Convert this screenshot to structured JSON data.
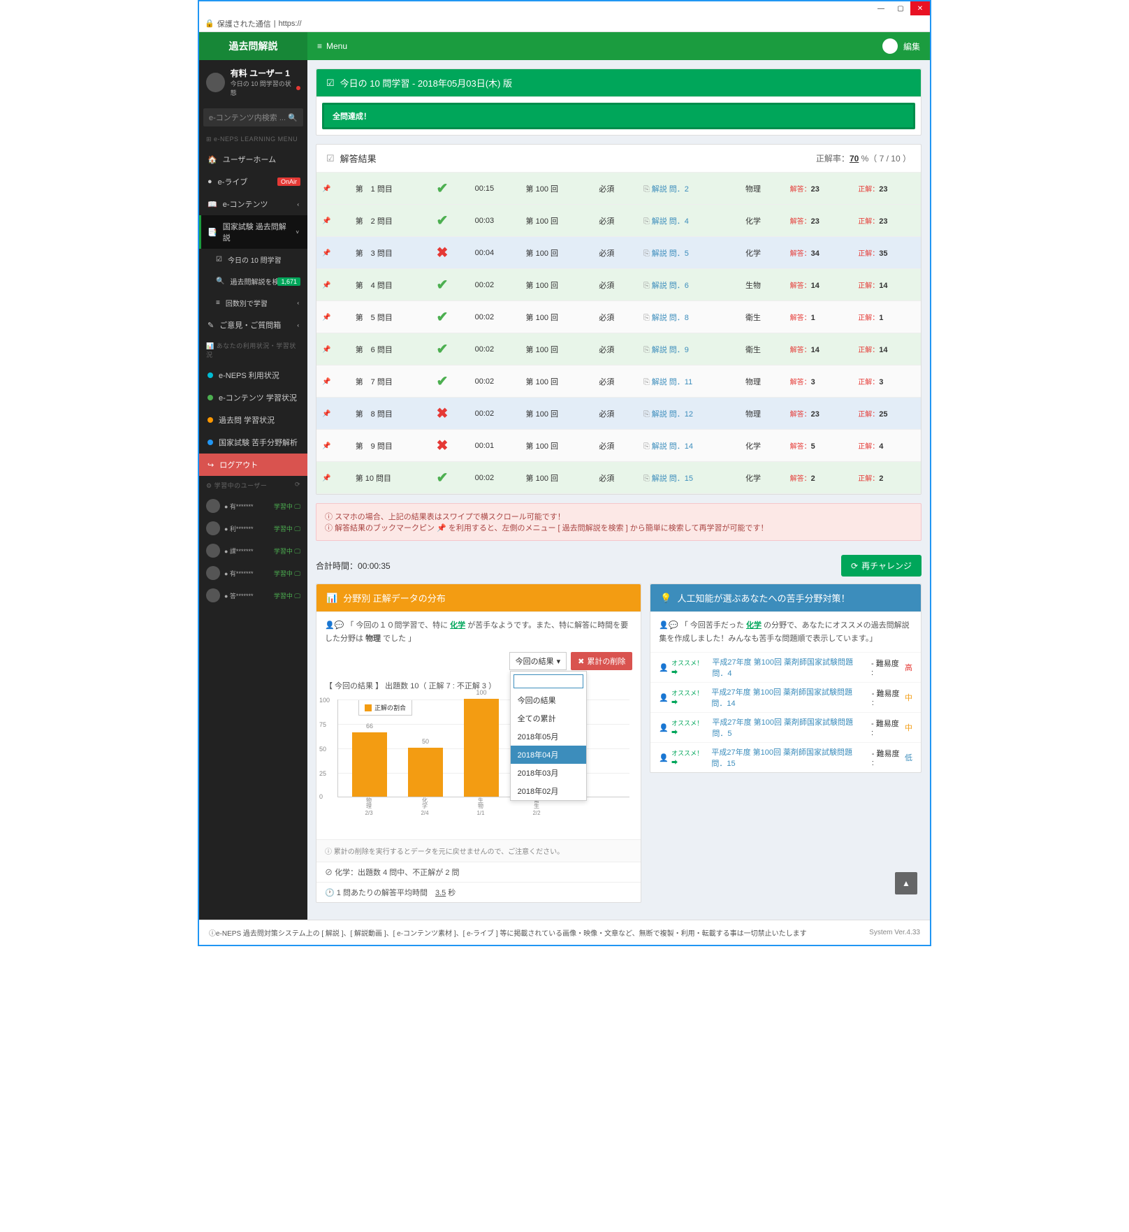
{
  "titlebar": {
    "min": "—",
    "max": "▢",
    "close": "✕"
  },
  "urlbar": {
    "secure": "保護された通信",
    "url": "https://"
  },
  "topbar": {
    "brand": "過去問解説",
    "menu": "Menu",
    "edit": "編集"
  },
  "user": {
    "name": "有料 ユーザー 1",
    "sub": "今日の 10 問学習の状態"
  },
  "search_placeholder": "e-コンテンツ内検索 ...",
  "side_header": "e-NEPS LEARNING MENU",
  "sidebar": [
    {
      "icon": "🏠",
      "label": "ユーザーホーム"
    },
    {
      "icon": "●",
      "label": "e-ライブ",
      "badge": "OnAir",
      "badge_cls": "onair"
    },
    {
      "icon": "📖",
      "label": "e-コンテンツ",
      "chev": "‹"
    },
    {
      "icon": "📑",
      "label": "国家試験 過去問解説",
      "chev": "˅",
      "active": true
    },
    {
      "icon": "☑",
      "label": "今日の 10 問学習",
      "sub": true
    },
    {
      "icon": "🔍",
      "label": "過去問解説を検索",
      "sub": true,
      "badge": "1,671"
    },
    {
      "icon": "≡",
      "label": "回数別で学習",
      "sub": true,
      "chev": "‹"
    },
    {
      "icon": "✎",
      "label": "ご意見・ご質問箱",
      "chev": "‹"
    }
  ],
  "side_header2": "あなたの利用状況・学習状況",
  "sidebar2": [
    {
      "dot": "dot-cyan",
      "label": "e-NEPS 利用状況"
    },
    {
      "dot": "dot-green",
      "label": "e-コンテンツ 学習状況"
    },
    {
      "dot": "dot-orange",
      "label": "過去問 学習状況"
    },
    {
      "dot": "dot-blue",
      "label": "国家試験 苦手分野解析"
    }
  ],
  "logout": "ログアウト",
  "side_header3": "学習中のユーザー",
  "online": [
    {
      "name": "有*******",
      "stat": "学習中"
    },
    {
      "name": "利*******",
      "stat": "学習中"
    },
    {
      "name": "課*******",
      "stat": "学習中"
    },
    {
      "name": "有*******",
      "stat": "学習中"
    },
    {
      "name": "答*******",
      "stat": "学習中"
    }
  ],
  "today_panel": {
    "title": "今日の 10 問学習 - 2018年05月03日(木) 版",
    "alert": "全問達成！"
  },
  "results_panel": {
    "title": "解答結果",
    "score_label": "正解率：",
    "score_pct": "70",
    "score_frac": " %（ 7 / 10 ）"
  },
  "rows": [
    {
      "n": "第　1 問目",
      "ok": true,
      "time": "00:15",
      "round": "第 100 回",
      "req": "必須",
      "link": "解説 問．2",
      "subj": "物理",
      "ans": "23",
      "cor": "23",
      "cls": "correct"
    },
    {
      "n": "第　2 問目",
      "ok": true,
      "time": "00:03",
      "round": "第 100 回",
      "req": "必須",
      "link": "解説 問．4",
      "subj": "化学",
      "ans": "23",
      "cor": "23",
      "cls": "correct"
    },
    {
      "n": "第　3 問目",
      "ok": false,
      "time": "00:04",
      "round": "第 100 回",
      "req": "必須",
      "link": "解説 問．5",
      "subj": "化学",
      "ans": "34",
      "cor": "35",
      "cls": "wrong"
    },
    {
      "n": "第　4 問目",
      "ok": true,
      "time": "00:02",
      "round": "第 100 回",
      "req": "必須",
      "link": "解説 問．6",
      "subj": "生物",
      "ans": "14",
      "cor": "14",
      "cls": "correct"
    },
    {
      "n": "第　5 問目",
      "ok": true,
      "time": "00:02",
      "round": "第 100 回",
      "req": "必須",
      "link": "解説 問．8",
      "subj": "衛生",
      "ans": "1",
      "cor": "1",
      "cls": "alt"
    },
    {
      "n": "第　6 問目",
      "ok": true,
      "time": "00:02",
      "round": "第 100 回",
      "req": "必須",
      "link": "解説 問．9",
      "subj": "衛生",
      "ans": "14",
      "cor": "14",
      "cls": "correct"
    },
    {
      "n": "第　7 問目",
      "ok": true,
      "time": "00:02",
      "round": "第 100 回",
      "req": "必須",
      "link": "解説 問．11",
      "subj": "物理",
      "ans": "3",
      "cor": "3",
      "cls": "alt"
    },
    {
      "n": "第　8 問目",
      "ok": false,
      "time": "00:02",
      "round": "第 100 回",
      "req": "必須",
      "link": "解説 問．12",
      "subj": "物理",
      "ans": "23",
      "cor": "25",
      "cls": "wrong"
    },
    {
      "n": "第　9 問目",
      "ok": false,
      "time": "00:01",
      "round": "第 100 回",
      "req": "必須",
      "link": "解説 問．14",
      "subj": "化学",
      "ans": "5",
      "cor": "4",
      "cls": "alt"
    },
    {
      "n": "第 10 問目",
      "ok": true,
      "time": "00:02",
      "round": "第 100 回",
      "req": "必須",
      "link": "解説 問．15",
      "subj": "化学",
      "ans": "2",
      "cor": "2",
      "cls": "correct"
    }
  ],
  "ans_label": "解答：",
  "cor_label": "正解：",
  "note1": "スマホの場合、上記の結果表はスワイプで横スクロール可能です！",
  "note2a": "解答結果のブックマークピン ",
  "note2b": " を利用すると、左側のメニュー [ 過去問解説を検索 ] から簡単に検索して再学習が可能です！",
  "total_time_label": "合計時間：",
  "total_time": "00:00:35",
  "rechallenge": "再チャレンジ",
  "dist_panel": {
    "title": "分野別 正解データの分布",
    "speech_a": "「 今回の１０問学習で、特に ",
    "kw": "化学",
    "speech_b": " が苦手なようです。また、特に解答に時間を要した分野は ",
    "kw2": "物理",
    "speech_c": " でした 」",
    "dd_label": "今回の結果",
    "del": "累計の削除",
    "dd_options": [
      "今回の結果",
      "全ての累計",
      "2018年05月",
      "2018年04月",
      "2018年03月",
      "2018年02月"
    ],
    "dd_selected": "2018年04月",
    "chart_title": "【 今回の結果 】 出題数 10（ 正解 7 : 不正解 3 ）",
    "legend": "正解の割合",
    "warn": "累計の削除を実行するとデータを元に戻せませんので、ご注意ください。",
    "stat1_a": "化学",
    "stat1_b": "：出題数 4 問中、不正解が 2 問",
    "stat2_a": "1 問あたりの解答平均時間　",
    "stat2_b": "3.5",
    "stat2_c": " 秒"
  },
  "ai_panel": {
    "title": "人工知能が選ぶあなたへの苦手分野対策！",
    "speech_a": "「 今回苦手だった ",
    "kw": "化学",
    "speech_b": " の分野で、あなたにオススメの過去問解説集を作成しました！みんなも苦手な問題順で表示しています。」",
    "recs": [
      {
        "label": "オススメ！ ➡",
        "link": "平成27年度 第100回 薬剤師国家試験問題 問．4",
        "diff": " - 難易度 : ",
        "lvl": "高",
        "cls": "diff-h"
      },
      {
        "label": "オススメ！ ➡",
        "link": "平成27年度 第100回 薬剤師国家試験問題 問．14",
        "diff": " - 難易度 : ",
        "lvl": "中",
        "cls": "diff-m"
      },
      {
        "label": "オススメ！ ➡",
        "link": "平成27年度 第100回 薬剤師国家試験問題 問．5",
        "diff": " - 難易度 : ",
        "lvl": "中",
        "cls": "diff-m"
      },
      {
        "label": "オススメ！ ➡",
        "link": "平成27年度 第100回 薬剤師国家試験問題 問．15",
        "diff": " - 難易度 : ",
        "lvl": "低",
        "cls": "diff-l"
      }
    ]
  },
  "footer": {
    "text": "e-NEPS 過去問対策システム上の [ 解説 ]、[ 解説動画 ]、[ e-コンテンツ素材 ]、[ e-ライブ ] 等に掲載されている画像・映像・文章など、無断で複製・利用・転載する事は一切禁止いたします",
    "ver": "System Ver.4.33"
  },
  "chart_data": {
    "type": "bar",
    "categories": [
      "物理 2/3",
      "化学 2/4",
      "生物 1/1",
      "衛生 2/2"
    ],
    "values": [
      66,
      50,
      100,
      100
    ],
    "title": "正解の割合",
    "ylabel": "",
    "xlabel": "",
    "ylim": [
      0,
      100
    ]
  }
}
